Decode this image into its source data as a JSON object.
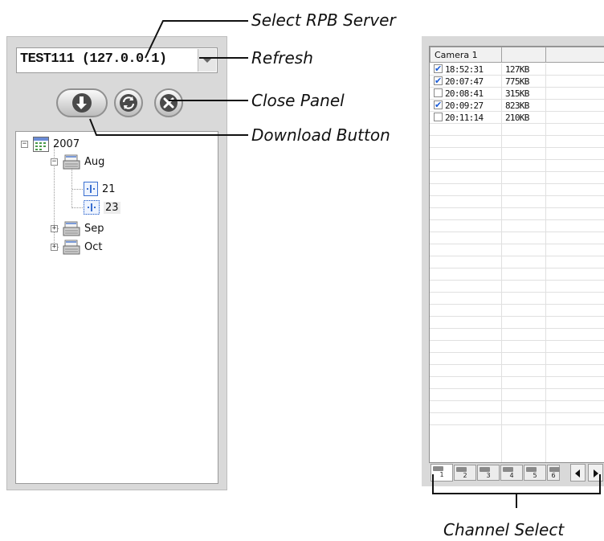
{
  "left_panel": {
    "server_combo": {
      "value": "TEST111 (127.0.0.1)"
    },
    "buttons": {
      "download": "download-arrow-icon",
      "refresh": "refresh-icon",
      "close": "close-x-icon"
    },
    "tree": {
      "year": "2007",
      "months": [
        {
          "label": "Aug",
          "expanded": true,
          "days": [
            "21",
            "23"
          ],
          "selected_day": "23"
        },
        {
          "label": "Sep",
          "expanded": false
        },
        {
          "label": "Oct",
          "expanded": false
        }
      ]
    }
  },
  "right_panel": {
    "columns": [
      "Camera 1",
      "",
      ""
    ],
    "rows": [
      {
        "time": "18:52:31",
        "size": "127KB",
        "checked": true
      },
      {
        "time": "20:07:47",
        "size": "775KB",
        "checked": true
      },
      {
        "time": "20:08:41",
        "size": "315KB",
        "checked": false
      },
      {
        "time": "20:09:27",
        "size": "823KB",
        "checked": true
      },
      {
        "time": "20:11:14",
        "size": "210KB",
        "checked": false
      }
    ],
    "channel_tabs": [
      "1",
      "2",
      "3",
      "4",
      "5",
      "6"
    ],
    "active_channel": "1"
  },
  "callouts": {
    "select_server": "Select RPB Server",
    "refresh": "Refresh",
    "close_panel": "Close Panel",
    "download_button": "Download Button",
    "channel_select": "Channel Select"
  },
  "colors": {
    "panel_bg": "#d9d9d9",
    "check_blue": "#1a5bd6",
    "accent_blue": "#2f6fd0"
  }
}
